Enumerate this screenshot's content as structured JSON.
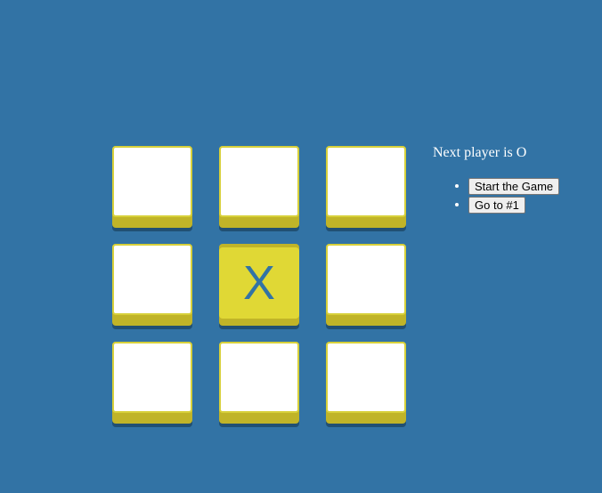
{
  "game": {
    "status": "Next player is O",
    "squares": [
      "",
      "",
      "",
      "",
      "X",
      "",
      "",
      "",
      ""
    ],
    "colors": {
      "background": "#3273a5",
      "tile": "#ffffff",
      "tile_border": "#d7d03a",
      "tile_filled": "#e0d835",
      "tile_base": "#c0b428",
      "mark": "#3273a5"
    }
  },
  "moves": [
    {
      "label": "Start the Game"
    },
    {
      "label": "Go to #1"
    }
  ]
}
